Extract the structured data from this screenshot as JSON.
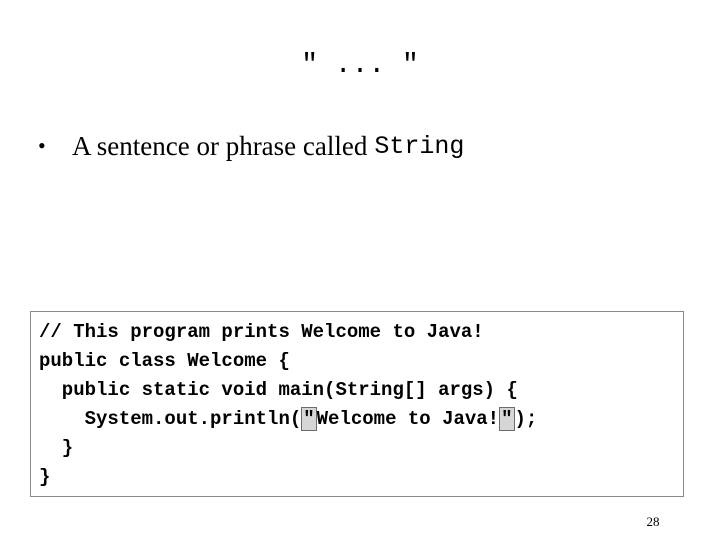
{
  "slide": {
    "title": "\" ... \"",
    "bullet": {
      "symbol": "•",
      "text": "A sentence or phrase called",
      "code_term": "String"
    },
    "code": {
      "line1": "// This program prints Welcome to Java!",
      "line2": "public class Welcome {",
      "line3": "  public static void main(String[] args) {",
      "line4_prefix": "    System.out.println(",
      "line4_quote_open": "\"",
      "line4_string": "Welcome to Java!",
      "line4_quote_close": "\"",
      "line4_suffix": ");",
      "line5": "  }",
      "line6": "}"
    },
    "page_number": "28"
  }
}
